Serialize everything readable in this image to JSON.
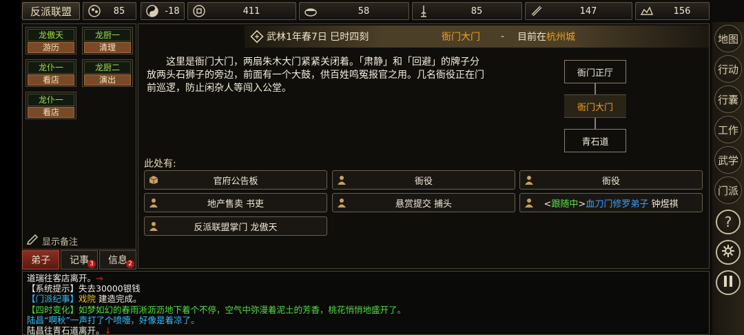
{
  "topbar": {
    "title_button": "反派联盟",
    "resources": [
      {
        "icon": "population-icon",
        "value": "85"
      },
      {
        "icon": "yin-yang-icon",
        "value": "-18"
      },
      {
        "icon": "coin-icon",
        "value": "411"
      },
      {
        "icon": "grain-icon",
        "value": "58"
      },
      {
        "icon": "pagoda-icon",
        "value": "85"
      },
      {
        "icon": "scroll-icon",
        "value": "147"
      },
      {
        "icon": "ore-icon",
        "value": "156"
      }
    ]
  },
  "disciples": [
    {
      "name": "龙傲天",
      "action": "游历"
    },
    {
      "name": "龙厨一",
      "action": "清理"
    },
    {
      "name": "龙仆一",
      "action": "看店"
    },
    {
      "name": "龙厨二",
      "action": "演出"
    },
    {
      "name": "龙仆一",
      "action": "看店"
    }
  ],
  "show_notes": "显示备注",
  "tabs": [
    {
      "label": "弟子",
      "badge": ""
    },
    {
      "label": "记事",
      "badge": "3"
    },
    {
      "label": "信息",
      "badge": "2"
    }
  ],
  "header": {
    "time": "武林1年春7日 巳时四刻",
    "location": "衙门大门",
    "dash": "-",
    "now_prefix": "目前在",
    "city": "杭州城"
  },
  "description": "这里是衙门大门，两扇朱木大门紧紧关闭着。「肃静」和「回避」的牌子分放两头石狮子的旁边，前面有一个大鼓，供百姓鸣冤报官之用。几名衙役正在门前巡逻，防止闲杂人等闯入公堂。",
  "map": {
    "north": "衙门正厅",
    "current": "衙门大门",
    "south": "青石道"
  },
  "here_label": "此处有:",
  "entities": [
    {
      "icon": "box-icon",
      "text": "官府公告板"
    },
    {
      "icon": "person-icon",
      "text": "衙役"
    },
    {
      "icon": "person-icon",
      "text": "衙役"
    },
    {
      "icon": "person-icon",
      "text": "地产售卖 书吏"
    },
    {
      "icon": "person-icon",
      "text": "悬赏提交 捕头"
    },
    {
      "icon": "person-icon",
      "prefix": "<",
      "tag": "跟随中",
      "suffix": ">",
      "faction": "血刀门修罗弟子",
      "name": " 钟煜祺"
    },
    {
      "icon": "person-icon",
      "text": "反派联盟掌门 龙傲天"
    }
  ],
  "log": [
    {
      "parts": [
        {
          "t": "道瑞往客店离开。",
          "c": "white"
        },
        {
          "t": "→",
          "c": "red"
        }
      ]
    },
    {
      "parts": [
        {
          "t": "【系统提示】失去30000银钱",
          "c": "white"
        }
      ]
    },
    {
      "parts": [
        {
          "t": "【门派纪事】",
          "c": "cyan"
        },
        {
          "t": "戏院",
          "c": "yellow"
        },
        {
          "t": " 建造完成。",
          "c": "white"
        }
      ]
    },
    {
      "parts": [
        {
          "t": "【四时变化】如梦如幻的春雨淅沥沥地下着个不停，空气中弥漫着泥土的芳香，桃花悄悄地盛开了。",
          "c": "green"
        }
      ]
    },
    {
      "parts": [
        {
          "t": "陆昌“啊秋”一声打了个喷嚏，好像是着凉了。",
          "c": "cyan"
        }
      ]
    },
    {
      "parts": [
        {
          "t": "陆昌往青石道离开。",
          "c": "white"
        },
        {
          "t": "↓",
          "c": "red"
        }
      ]
    }
  ],
  "side_menu": [
    {
      "label": "地图",
      "icon": "map-icon"
    },
    {
      "label": "行动",
      "icon": "action-icon"
    },
    {
      "label": "行囊",
      "icon": "bag-icon"
    },
    {
      "label": "工作",
      "icon": "work-icon"
    },
    {
      "label": "武学",
      "icon": "martial-icon"
    },
    {
      "label": "门派",
      "icon": "sect-icon"
    },
    {
      "label": "?",
      "icon": "help-icon"
    },
    {
      "label": "",
      "icon": "settings-gear-icon"
    },
    {
      "label": "",
      "icon": "pause-icon"
    }
  ]
}
